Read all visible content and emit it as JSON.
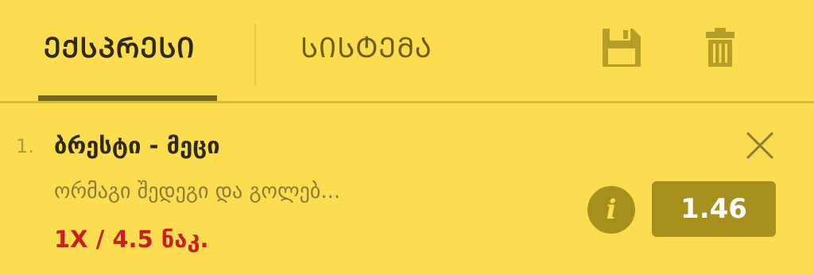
{
  "tabs": {
    "express_label": "ᲔᲥᲡᲞᲠᲔᲡᲘ",
    "system_label": "ᲡᲘᲡᲢᲔᲛᲐ",
    "active": "express"
  },
  "toolbar": {
    "save_icon": "save-icon",
    "delete_icon": "trash-icon"
  },
  "bet": {
    "index": "1.",
    "event": "ბრესტი - მეცი",
    "market": "ორმაგი შედეგი და გოლებ...",
    "selection": "1X / 4.5 ნაკ.",
    "odds": "1.46",
    "info_icon": "info-icon",
    "remove_icon": "close-icon"
  },
  "colors": {
    "background": "#fbdd4f",
    "accent_dark": "#776718",
    "button": "#a68f1d",
    "selection_red": "#c81f1f"
  }
}
